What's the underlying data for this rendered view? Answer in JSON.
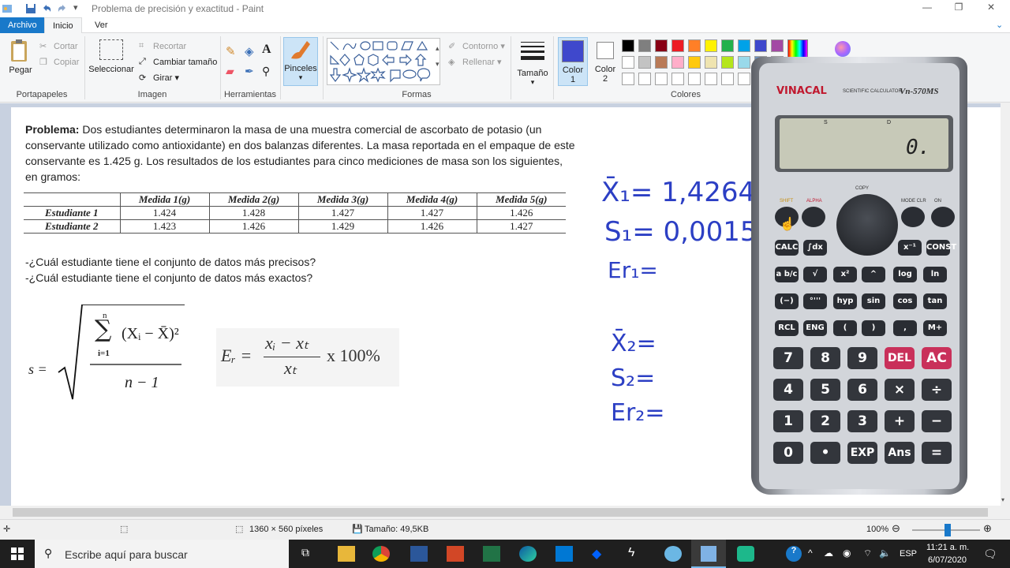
{
  "window": {
    "title": "Problema de precisión y exactitud - Paint",
    "min_label": "—",
    "max_label": "❐",
    "close_label": "✕"
  },
  "menu": {
    "archivo": "Archivo",
    "inicio": "Inicio",
    "ver": "Ver"
  },
  "ribbon": {
    "portapapeles": {
      "pegar": "Pegar",
      "cortar": "Cortar",
      "copiar": "Copiar",
      "label": "Portapapeles"
    },
    "imagen": {
      "seleccionar": "Seleccionar",
      "recortar": "Recortar",
      "cambiar_tamano": "Cambiar tamaño",
      "girar": "Girar",
      "label": "Imagen"
    },
    "herramientas": {
      "label": "Herramientas",
      "text_tool": "A"
    },
    "pinceles": "Pinceles",
    "formas": {
      "contorno": "Contorno",
      "rellenar": "Rellenar",
      "label": "Formas"
    },
    "tamano": "Tamaño",
    "color1": {
      "label": "Color",
      "num": "1"
    },
    "color2": {
      "label": "Color",
      "num": "2"
    },
    "colores_label": "Colores",
    "palette_row1": [
      "#000000",
      "#7f7f7f",
      "#880015",
      "#ed1c24",
      "#ff7f27",
      "#fff200",
      "#22b14c",
      "#00a2e8",
      "#3f48cc",
      "#a349a4"
    ],
    "palette_row2": [
      "#ffffff",
      "#c3c3c3",
      "#b97a57",
      "#ffaec9",
      "#ffc90e",
      "#efe4b0",
      "#b5e61d",
      "#99d9ea",
      "#7092be",
      "#c8bfe7"
    ],
    "color1_value": "#3f48cc",
    "color2_value": "#ffffff"
  },
  "problem": {
    "label": "Problema:",
    "text": " Dos estudiantes determinaron la masa de una muestra comercial de ascorbato de potasio (un conservante utilizado como antioxidante) en dos balanzas diferentes. La masa reportada en el empaque de este conservante es 1.425 g. Los resultados de los estudiantes para cinco mediciones de masa son los siguientes, en gramos:"
  },
  "table": {
    "headers": [
      "Medida 1(g)",
      "Medida 2(g)",
      "Medida 3(g)",
      "Medida 4(g)",
      "Medida 5(g)"
    ],
    "rows": [
      {
        "name": "Estudiante 1",
        "values": [
          "1.424",
          "1.428",
          "1.427",
          "1.427",
          "1.426"
        ]
      },
      {
        "name": "Estudiante 2",
        "values": [
          "1.423",
          "1.426",
          "1.429",
          "1.426",
          "1.427"
        ]
      }
    ]
  },
  "questions": [
    "-¿Cuál estudiante tiene el conjunto de datos más precisos?",
    "-¿Cuál estudiante tiene el conjunto de datos más exactos?"
  ],
  "formulas": {
    "s_lhs": "s =",
    "s_sum_top": "n",
    "s_sum_bottom": "i=1",
    "s_term": "(Xᵢ − X̄)²",
    "s_den": "n − 1",
    "er_lhs": "Eᵣ =",
    "er_num": "xᵢ − xₜ",
    "er_den": "xₜ",
    "er_tail": "x 100%"
  },
  "handwriting": {
    "x1": "X̄₁= 1,4264",
    "s1": "S₁= 0,0015",
    "er1": "Er₁=",
    "x2": "X̄₂=",
    "s2": "S₂=",
    "er2": "Er₂="
  },
  "calculator": {
    "brand": "VINACAL",
    "subtitle": "SCIENTIFIC CALCULATOR",
    "model": "Vn-570MS",
    "display": "0.",
    "indicator_s": "S",
    "indicator_d": "D",
    "keys": {
      "shift": "SHIFT",
      "alpha": "ALPHA",
      "mode": "MODE CLR",
      "on": "ON",
      "copy": "COPY",
      "calc": "CALC",
      "int": "∫dx",
      "xinv": "x⁻¹",
      "const": "CONST",
      "abc": "a b/c",
      "sqrt": "√",
      "x2": "x²",
      "pow": "^",
      "log": "log",
      "ln": "ln",
      "neg": "(−)",
      "dms": "°'''",
      "hyp": "hyp",
      "sin": "sin",
      "cos": "cos",
      "tan": "tan",
      "rcl": "RCL",
      "eng": "ENG",
      "lpar": "(",
      "rpar": ")",
      "comma": ",",
      "mplus": "M+",
      "n7": "7",
      "n8": "8",
      "n9": "9",
      "del": "DEL",
      "ac": "AC",
      "n4": "4",
      "n5": "5",
      "n6": "6",
      "mul": "×",
      "div": "÷",
      "n1": "1",
      "n2": "2",
      "n3": "3",
      "add": "+",
      "sub": "−",
      "n0": "0",
      "dot": "•",
      "exp": "EXP",
      "ans": "Ans",
      "eq": "="
    }
  },
  "status": {
    "dimensions": "1360 × 560 píxeles",
    "size": "Tamaño: 49,5KB",
    "zoom": "100%"
  },
  "taskbar": {
    "search_placeholder": "Escribe aquí para buscar",
    "lang": "ESP",
    "time": "11:21 a. m.",
    "date": "6/07/2020"
  }
}
